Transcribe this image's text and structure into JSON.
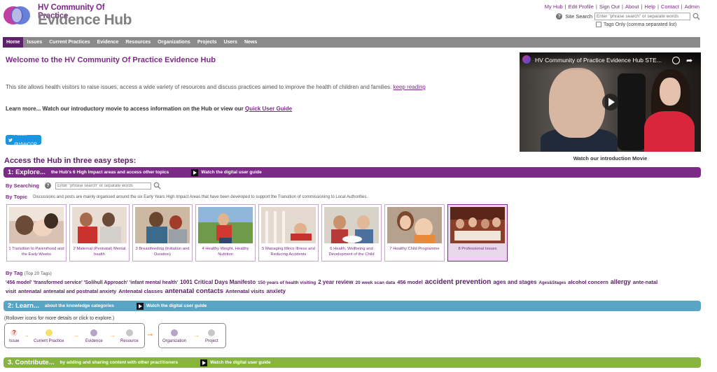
{
  "header": {
    "logo_line1": "HV Community Of Practice",
    "logo_line2": "Evidence Hub",
    "top_links": [
      "My Hub",
      "Edit Profile",
      "Sign Out",
      "About",
      "Help",
      "Contact",
      "Admin"
    ],
    "site_search_label": "Site Search",
    "site_search_placeholder": "Enter \"phrase search\" or separate words",
    "tags_only_label": "Tags Only (comma separated list)"
  },
  "nav": [
    "Home",
    "Issues",
    "Current Practices",
    "Evidence",
    "Resources",
    "Organizations",
    "Projects",
    "Users",
    "News"
  ],
  "welcome": {
    "title": "Welcome to the HV Community Of Practice Evidence Hub",
    "text": "This site allows health visitors to raise issues, access a wide variety of resources and discuss practices aimed to improve the health of children and families.",
    "keep_reading": "keep reading",
    "learn_more": "Learn more... Watch our introductory movie to access information on the Hub or view our",
    "quick_guide": "Quick User Guide",
    "follow": "Follow @HVeCOP"
  },
  "video": {
    "title": "HV Community of Practice Evidence Hub STE...",
    "caption": "Watch our introduction Movie"
  },
  "access_title": "Access the Hub in three easy steps:",
  "step1": {
    "num": "1: Explore...",
    "sub": "the Hub's 6 High Impact areas and access other topics",
    "watch": "Watch the digital user guide",
    "by_searching": "By Searching",
    "search_placeholder": "Enter \"phrase search\" or separate words",
    "by_topic": "By Topic",
    "topic_desc": "Discussions and posts are mainly organised around the six Early Years High Impact Areas that have been developed to support the Transition of commissioning to Local Authorities.",
    "topics": [
      {
        "label": "1 Transition to Parenthood and the Early Weeks"
      },
      {
        "label": "2 Maternal (Perinatal) Mental health"
      },
      {
        "label": "3 Breastfeeding (Initiation and Duration)"
      },
      {
        "label": "4 Healthy Weight, Healthy Nutrition"
      },
      {
        "label": "5 Managing Minor Illness and Reducing Accidents"
      },
      {
        "label": "6 Health, Wellbeing and Development of the Child"
      },
      {
        "label": "7 Healthy Child Programme"
      },
      {
        "label": "8 Professional Issues"
      }
    ],
    "by_tag": "By Tag",
    "tag_count": "(Top 20 Tags)",
    "tags": [
      {
        "t": "'456 model' 'transformed service' 'Solihull Approach' 'infant mental health'",
        "s": 7
      },
      {
        "t": "1001 Critical Days Manifesto",
        "s": 8
      },
      {
        "t": "150 years of health visiting",
        "s": 6.5
      },
      {
        "t": "2 year review",
        "s": 8
      },
      {
        "t": "20 week scan data",
        "s": 6.5
      },
      {
        "t": "456 model",
        "s": 7.5
      },
      {
        "t": "accident prevention",
        "s": 10
      },
      {
        "t": "ages and stages",
        "s": 8
      },
      {
        "t": "Ages&Stages",
        "s": 6
      },
      {
        "t": "alcohol concern",
        "s": 7.5
      },
      {
        "t": "allergy",
        "s": 9
      },
      {
        "t": "ante-natal visit",
        "s": 7.5
      },
      {
        "t": "antenatal",
        "s": 7.5
      },
      {
        "t": "antenatal and postnatal anxiety",
        "s": 7
      },
      {
        "t": "Antenatal classes",
        "s": 7.5
      },
      {
        "t": "antenatal contacts",
        "s": 9.5
      },
      {
        "t": "Antenatal visits",
        "s": 7.5
      },
      {
        "t": "anxiety",
        "s": 8
      }
    ]
  },
  "step2": {
    "num": "2: Learn...",
    "sub": "about the knowledge categories",
    "watch": "Watch the digital user guide",
    "rollover": "(Rollover icons for more details or click to explore.)",
    "items": [
      "Issue",
      "Current Practice",
      "Evidence",
      "Resource",
      "Organization",
      "Project"
    ]
  },
  "step3": {
    "num": "3. Contribute...",
    "sub": "by adding and sharing content with other practitioners",
    "watch": "Watch the digital user guide"
  },
  "colors": {
    "purple": "#7b2b86",
    "dark_purple": "#5c2168",
    "blue": "#5aa5c6",
    "green": "#86b43f",
    "orange": "#f3a23c",
    "nav_gray": "#8a8a8a"
  }
}
